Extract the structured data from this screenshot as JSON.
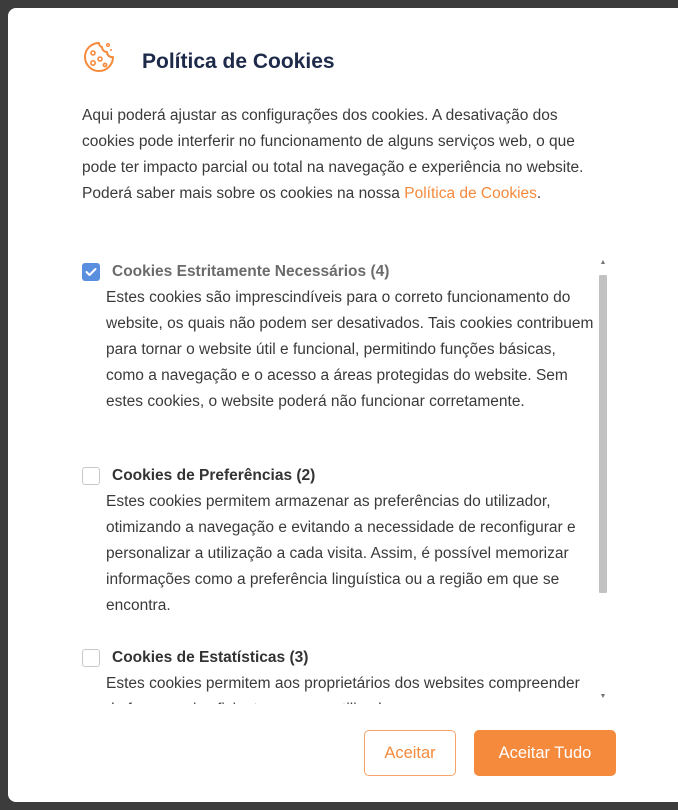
{
  "modal": {
    "title": "Política de Cookies",
    "icon": "cookie-icon",
    "intro_text": "Aqui poderá ajustar as configurações dos cookies. A desativação dos cookies pode interferir no funcionamento de alguns serviços web, o que pode ter impacto parcial ou total na navegação e experiência no website. Poderá saber mais sobre os cookies na nossa ",
    "intro_link": "Política de Cookies",
    "intro_end": ".",
    "accent_color": "#f58a3c",
    "categories": [
      {
        "title": "Cookies Estritamente Necessários (4)",
        "checked": true,
        "description": "Estes cookies são imprescindíveis para o correto funcionamento do website, os quais não podem ser desativados. Tais cookies contribuem para tornar o website útil e funcional, permitindo funções básicas, como a navegação e o acesso a áreas protegidas do website. Sem estes cookies, o website poderá não funcionar corretamente."
      },
      {
        "title": "Cookies de Preferências (2)",
        "checked": false,
        "description": "Estes cookies permitem armazenar as preferências do utilizador, otimizando a navegação e evitando a necessidade de reconfigurar e personalizar a utilização a cada visita. Assim, é possível memorizar informações como a preferência linguística ou a região em que se encontra."
      },
      {
        "title": "Cookies de Estatísticas (3)",
        "checked": false,
        "description": "Estes cookies permitem aos proprietários dos websites compreender de forma mais eficiente como os utilizadores"
      }
    ],
    "buttons": {
      "accept": "Aceitar",
      "accept_all": "Aceitar Tudo"
    }
  }
}
